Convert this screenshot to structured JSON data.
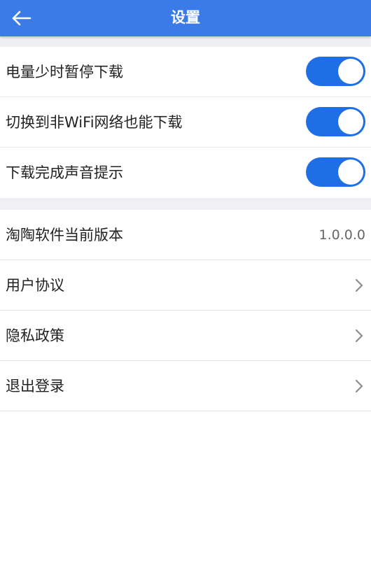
{
  "header": {
    "title": "设置",
    "back_icon": "arrow-left-icon",
    "background_color": "#3a7be8"
  },
  "toggles": [
    {
      "label": "电量少时暂停下载",
      "on": true
    },
    {
      "label": "切换到非WiFi网络也能下载",
      "on": true
    },
    {
      "label": "下载完成声音提示",
      "on": true
    }
  ],
  "version_row": {
    "label": "淘陶软件当前版本",
    "value": "1.0.0.0"
  },
  "nav_rows": [
    {
      "label": "用户协议",
      "icon": "chevron-right-icon"
    },
    {
      "label": "隐私政策",
      "icon": "chevron-right-icon"
    },
    {
      "label": "退出登录",
      "icon": "chevron-right-icon"
    }
  ],
  "colors": {
    "accent": "#1e6fe6",
    "section_gap": "#f0eff4"
  }
}
